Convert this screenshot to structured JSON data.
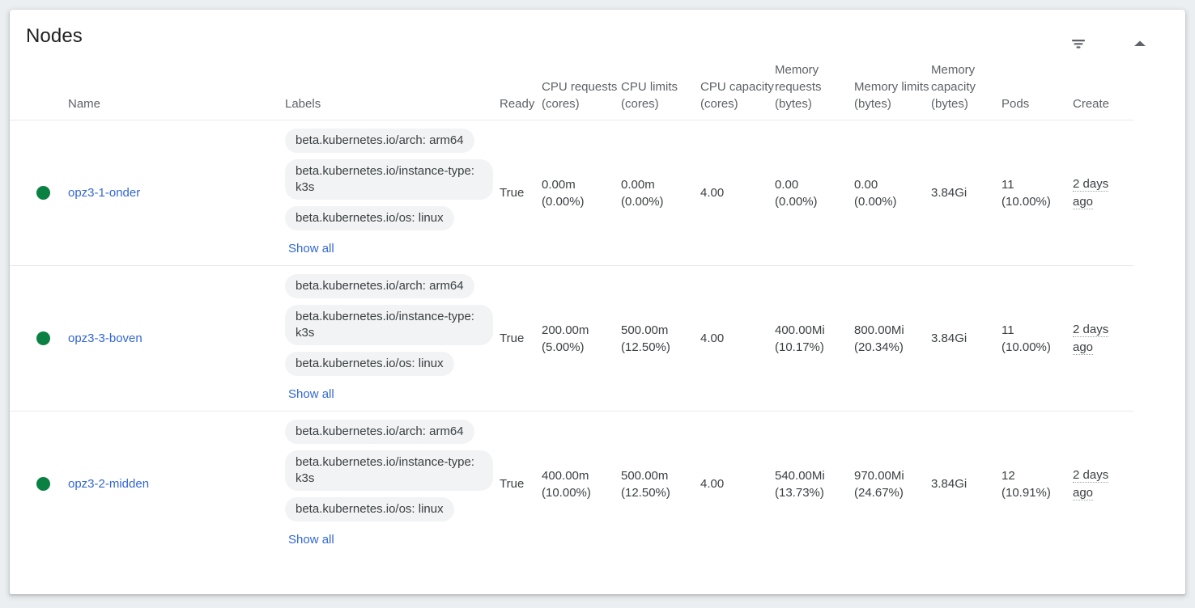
{
  "card": {
    "title": "Nodes",
    "actions": [
      {
        "name": "filter-icon",
        "label": "Filter"
      },
      {
        "name": "collapse-icon",
        "label": "Collapse"
      }
    ]
  },
  "table": {
    "columns": [
      {
        "key": "status",
        "label": ""
      },
      {
        "key": "name",
        "label": "Name"
      },
      {
        "key": "labels",
        "label": "Labels"
      },
      {
        "key": "ready",
        "label": "Ready"
      },
      {
        "key": "cpu_requests",
        "label": "CPU requests (cores)"
      },
      {
        "key": "cpu_limits",
        "label": "CPU limits (cores)"
      },
      {
        "key": "cpu_capacity",
        "label": "CPU capacity (cores)"
      },
      {
        "key": "memory_requests",
        "label": "Memory requests (bytes)"
      },
      {
        "key": "memory_limits",
        "label": "Memory limits (bytes)"
      },
      {
        "key": "memory_capacity",
        "label": "Memory capacity (bytes)"
      },
      {
        "key": "pods",
        "label": "Pods"
      },
      {
        "key": "created",
        "label": "Create"
      },
      {
        "key": "menu",
        "label": ""
      }
    ],
    "show_all_label": "Show all",
    "rows": [
      {
        "status": "ready",
        "name": "opz3-1-onder",
        "labels": [
          "beta.kubernetes.io/arch: arm64",
          "beta.kubernetes.io/instance-type: k3s",
          "beta.kubernetes.io/os: linux"
        ],
        "ready": "True",
        "cpu_requests": {
          "value": "0.00m",
          "percent": "(0.00%)"
        },
        "cpu_limits": {
          "value": "0.00m",
          "percent": "(0.00%)"
        },
        "cpu_capacity": "4.00",
        "memory_requests": {
          "value": "0.00",
          "percent": "(0.00%)"
        },
        "memory_limits": {
          "value": "0.00",
          "percent": "(0.00%)"
        },
        "memory_capacity": "3.84Gi",
        "pods": {
          "value": "11",
          "percent": "(10.00%)"
        },
        "created": "2 days ago"
      },
      {
        "status": "ready",
        "name": "opz3-3-boven",
        "labels": [
          "beta.kubernetes.io/arch: arm64",
          "beta.kubernetes.io/instance-type: k3s",
          "beta.kubernetes.io/os: linux"
        ],
        "ready": "True",
        "cpu_requests": {
          "value": "200.00m",
          "percent": "(5.00%)"
        },
        "cpu_limits": {
          "value": "500.00m",
          "percent": "(12.50%)"
        },
        "cpu_capacity": "4.00",
        "memory_requests": {
          "value": "400.00Mi",
          "percent": "(10.17%)"
        },
        "memory_limits": {
          "value": "800.00Mi",
          "percent": "(20.34%)"
        },
        "memory_capacity": "3.84Gi",
        "pods": {
          "value": "11",
          "percent": "(10.00%)"
        },
        "created": "2 days ago"
      },
      {
        "status": "ready",
        "name": "opz3-2-midden",
        "labels": [
          "beta.kubernetes.io/arch: arm64",
          "beta.kubernetes.io/instance-type: k3s",
          "beta.kubernetes.io/os: linux"
        ],
        "ready": "True",
        "cpu_requests": {
          "value": "400.00m",
          "percent": "(10.00%)"
        },
        "cpu_limits": {
          "value": "500.00m",
          "percent": "(12.50%)"
        },
        "cpu_capacity": "4.00",
        "memory_requests": {
          "value": "540.00Mi",
          "percent": "(13.73%)"
        },
        "memory_limits": {
          "value": "970.00Mi",
          "percent": "(24.67%)"
        },
        "memory_capacity": "3.84Gi",
        "pods": {
          "value": "12",
          "percent": "(10.91%)"
        },
        "created": "2 days ago"
      }
    ]
  },
  "colors": {
    "status_ready": "#0b8043",
    "link": "#3367d6",
    "chip_bg": "#f1f3f4",
    "page_bg": "#eceff1"
  }
}
